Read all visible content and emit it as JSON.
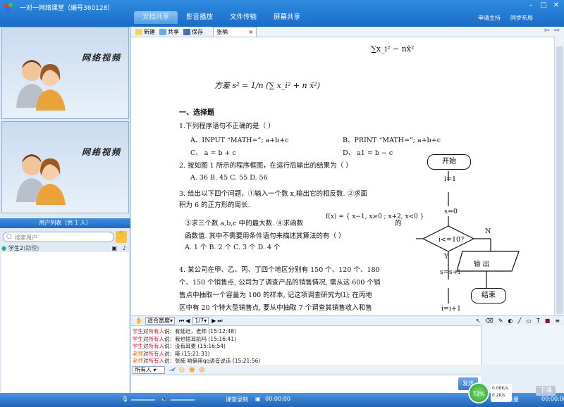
{
  "app": {
    "title": "一对一网络课堂（编号360128）",
    "nav_tabs": [
      "文档共享",
      "影音播放",
      "文件传输",
      "屏幕共享"
    ],
    "top_right": [
      "申请主持",
      "同步布局"
    ]
  },
  "left": {
    "video_caption": "网络视频",
    "userlist_title": "用户列表（共 1 人）",
    "search_placeholder": "搜索用户",
    "user": {
      "name": "学生2",
      "role": "(助理)"
    }
  },
  "doc": {
    "toolbar": {
      "new": "新建",
      "share": "共享",
      "save": "保存",
      "tab": "张楠"
    },
    "zoom": "适合宽度",
    "page": "1/7",
    "content": {
      "formula_top": "∑x_i² − nx̄²",
      "variance": "方差 s² = 1/n (∑ x_i² + n x̄²)",
      "section": "一、选择题",
      "q1": "1.下列程序语句不正确的是（    ）",
      "q1_a": "A、INPUT “MATH=”; a+b+c",
      "q1_b": "B、PRINT “MATH=”; a+b+c",
      "q1_c": "C、 a = b + c",
      "q1_d": "D、 a1 = b − c",
      "q2": "2. 按如图 1 所示的程序框图，在运行后输出的结果为（    ）",
      "q2_opts": "A. 36       B. 45       C. 55       D. 56",
      "q3_l1": "3.  给出以下四个问题，①输入一个数  x,输出它的相反数. ②求面",
      "q3_l2": "积为 6 的正方形的周长.",
      "q3_l3": "③求三个数 a,b,c 中的最大数. ④求函数",
      "q3_fx": "f(x) = { x−1, x≥0 ; x+2, x<0 }",
      "q3_l3b": "的",
      "q3_l4": "函数值.    其中不需要用条件语句来描述其算法的有（    ）",
      "q3_opts": "A. 1 个              B. 2 个             C. 3 个             D. 4 个",
      "q4_l1": "4. 某公司在甲、乙、丙、丁四个地区分别有 150 个、120 个、180",
      "q4_l2": "个、150 个销售点, 公司为了调查产品的销售情况, 需从这 600 个销",
      "q4_l3": "售点中抽取一个容量为 100 的样本, 记这项调查研究为⑴; 在丙地",
      "q4_l4": "区中有 20 个特大型销售点, 要从中抽取 7 个调查其销售收入和售"
    },
    "flow": {
      "start": "开始",
      "i1": "i=1",
      "s0": "s=0",
      "cond": "i<=10?",
      "n": "N",
      "y": "Y",
      "output": "输  出",
      "ssi": "s=s+i",
      "end": "结束",
      "ii": "i=i+1"
    }
  },
  "chat": {
    "lines": [
      {
        "who": "学生",
        "to": "对",
        "tgt": "所有人",
        "say": "说：",
        "msg": "有延迟，老师 (15:12:48)"
      },
      {
        "who": "学生",
        "to": "对",
        "tgt": "所有人",
        "say": "说：",
        "msg": "我也插耳机吗 (15:16:41)"
      },
      {
        "who": "学生",
        "to": "对",
        "tgt": "所有人",
        "say": "说：",
        "msg": "没有耳麦 (15:16:54)"
      },
      {
        "who": "老师",
        "to": "对",
        "tgt": "所有人",
        "say": "说：",
        "msg": "哦 (15:21:31)"
      },
      {
        "who": "老师",
        "to": "对",
        "tgt": "所有人",
        "say": "说：",
        "msg": "张楠 咱俩用qq语音说话 (15:21:56)"
      }
    ],
    "target": "所有人",
    "send": "发送"
  },
  "status": {
    "record": "课堂录制",
    "time": "00:00:00",
    "net_pct": "72%",
    "up": "0.08K/s",
    "down": "0.2K/s",
    "quality_time": "00:00:00",
    "end": "下课",
    "quality_label": "网络质量"
  }
}
